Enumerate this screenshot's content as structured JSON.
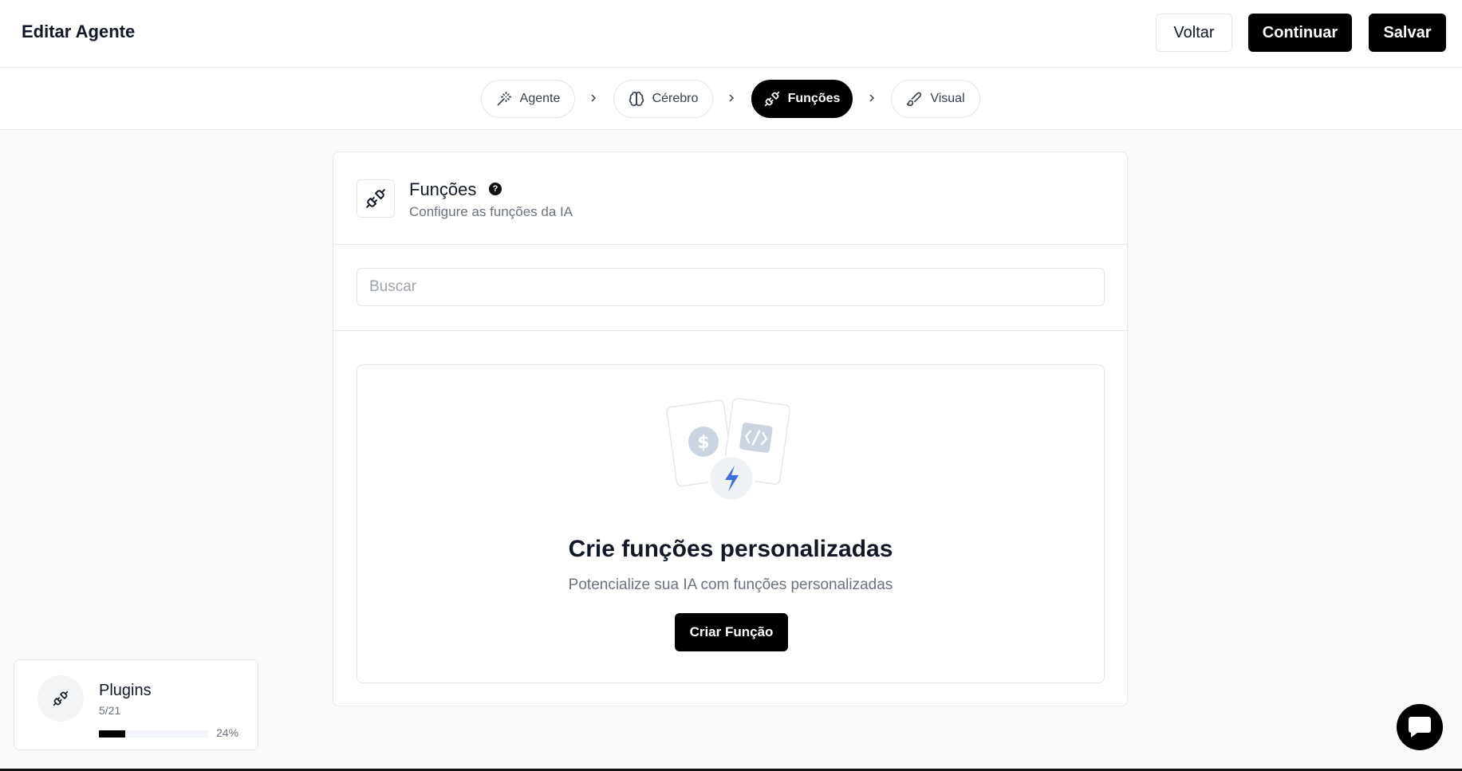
{
  "header": {
    "title": "Editar Agente",
    "back_label": "Voltar",
    "continue_label": "Continuar",
    "save_label": "Salvar"
  },
  "steps": [
    {
      "label": "Agente",
      "icon": "wand-icon"
    },
    {
      "label": "Cérebro",
      "icon": "brain-icon"
    },
    {
      "label": "Funções",
      "icon": "plug-icon",
      "active": true
    },
    {
      "label": "Visual",
      "icon": "brush-icon"
    }
  ],
  "section": {
    "title": "Funções",
    "subtitle": "Configure as funções da IA",
    "help_icon": "?"
  },
  "search": {
    "placeholder": "Buscar",
    "value": ""
  },
  "empty_state": {
    "title": "Crie funções personalizadas",
    "subtitle": "Potencialize sua IA com funções personalizadas",
    "button_label": "Criar Função"
  },
  "plugins": {
    "title": "Plugins",
    "count": "5/21",
    "percent": "24%",
    "progress": 0.24
  },
  "colors": {
    "accent": "#000000",
    "background": "#f8fafc",
    "lightning": "#3b6fe0"
  }
}
